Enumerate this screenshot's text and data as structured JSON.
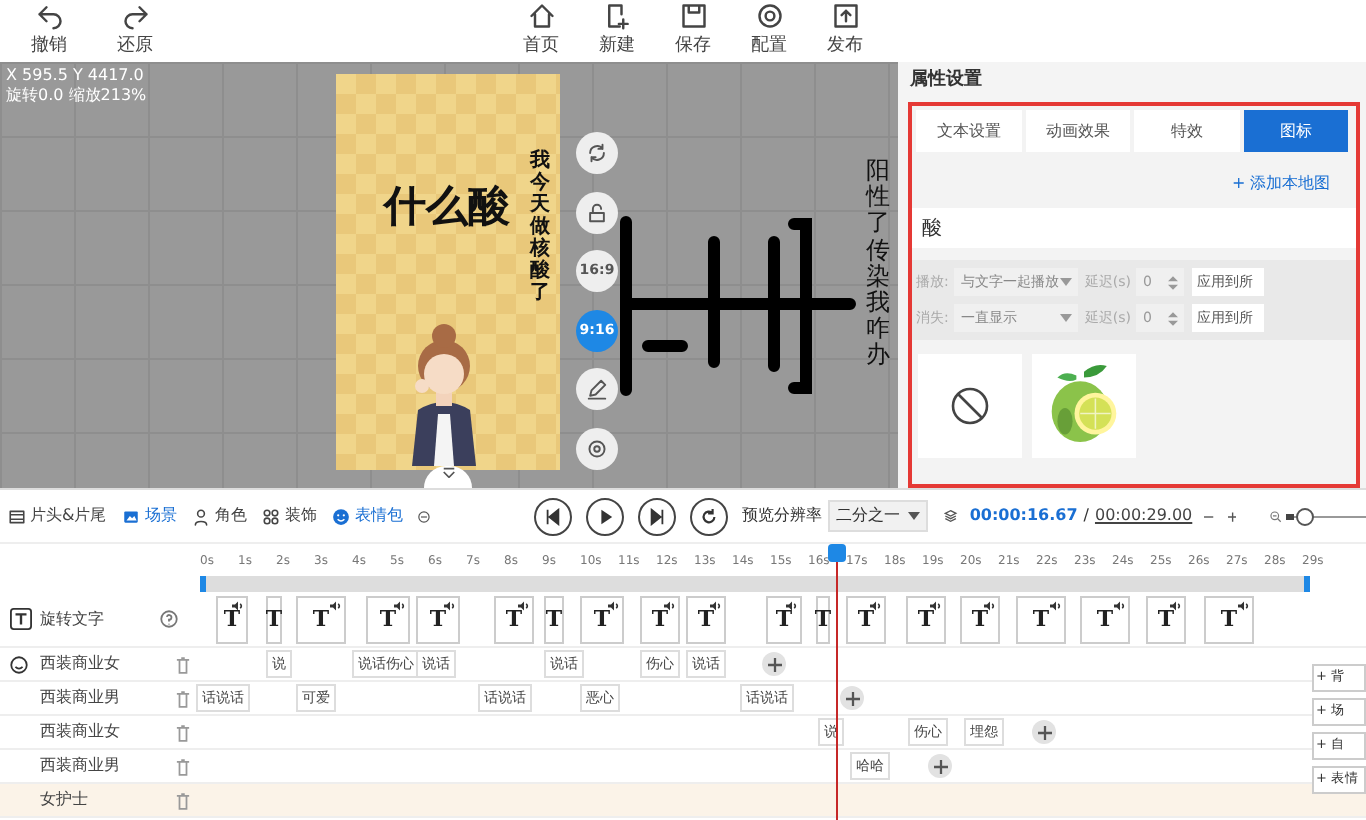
{
  "toolbar": {
    "history": [
      {
        "label": "撤销"
      },
      {
        "label": "还原"
      }
    ],
    "actions": [
      {
        "label": "首页"
      },
      {
        "label": "新建"
      },
      {
        "label": "保存"
      },
      {
        "label": "配置"
      },
      {
        "label": "发布"
      }
    ]
  },
  "canvas": {
    "position": "X 595.5 Y 4417.0",
    "transform": "旋转0.0 缩放213%",
    "title": "什么酸",
    "caption": "我今天做核酸了",
    "side_text": "阳性了传染我咋办",
    "tools": [
      {
        "kind": "icon",
        "selected": false
      },
      {
        "kind": "icon",
        "selected": false
      },
      {
        "kind": "text",
        "label": "16:9",
        "selected": false
      },
      {
        "kind": "text",
        "label": "9:16",
        "selected": true
      },
      {
        "kind": "icon",
        "selected": false
      },
      {
        "kind": "icon",
        "selected": false
      }
    ]
  },
  "panel": {
    "title": "属性设置",
    "tabs": [
      {
        "label": "文本设置",
        "selected": false
      },
      {
        "label": "动画效果",
        "selected": false
      },
      {
        "label": "特效",
        "selected": false
      },
      {
        "label": "图标",
        "selected": true
      }
    ],
    "add_link": "+ 添加本地图",
    "search": {
      "value": "酸"
    },
    "settings": [
      {
        "label": "播放:",
        "value": "与文字一起播放",
        "delay_label": "延迟(s)",
        "delay": "0",
        "apply": "应用到所"
      },
      {
        "label": "消失:",
        "value": "一直显示",
        "delay_label": "延迟(s)",
        "delay": "0",
        "apply": "应用到所"
      }
    ],
    "icons": [
      {
        "kind": "none"
      },
      {
        "kind": "picture"
      }
    ]
  },
  "timeline": {
    "tabs": [
      {
        "label": "片头&片尾",
        "selected": false
      },
      {
        "label": "场景",
        "selected": true
      },
      {
        "label": "角色",
        "selected": false
      },
      {
        "label": "装饰",
        "selected": false
      },
      {
        "label": "表情包",
        "selected": true
      }
    ],
    "resolution_label": "预览分辨率",
    "resolution": "二分之一",
    "current_time": "00:00:16.67",
    "separator": "/",
    "total_time": "00:00:29.00",
    "zoom": {
      "level": 0.08
    },
    "ticks": [
      "0s",
      "1s",
      "2s",
      "3s",
      "4s",
      "5s",
      "6s",
      "7s",
      "8s",
      "9s",
      "10s",
      "11s",
      "12s",
      "13s",
      "14s",
      "15s",
      "16s",
      "17s",
      "18s",
      "19s",
      "20s",
      "21s",
      "22s",
      "23s",
      "24s",
      "25s",
      "26s",
      "27s",
      "28s",
      "29s"
    ],
    "text_track": {
      "label": "旋转文字",
      "clips": [
        "T",
        "T",
        "T",
        "T",
        "T",
        "T",
        "T",
        "T",
        "T",
        "T",
        "T",
        "T",
        "T",
        "T",
        "T",
        "T",
        "T",
        "T",
        "T"
      ]
    },
    "tracks": [
      {
        "name": "西装商业女",
        "clips": [
          "说",
          "说话伤心",
          "说话",
          "说话",
          "伤心",
          "说话"
        ]
      },
      {
        "name": "西装商业男",
        "clips": [
          "话说话",
          "可爱",
          "话说话",
          "恶心",
          "话说话"
        ]
      },
      {
        "name": "西装商业女",
        "clips": [
          "说",
          "伤心",
          "埋怨"
        ]
      },
      {
        "name": "西装商业男",
        "clips": [
          "哈哈"
        ]
      },
      {
        "name": "女护士"
      }
    ],
    "add_buttons": [
      "+ 背",
      "+ 场",
      "+ 自",
      "+ 表情"
    ]
  }
}
